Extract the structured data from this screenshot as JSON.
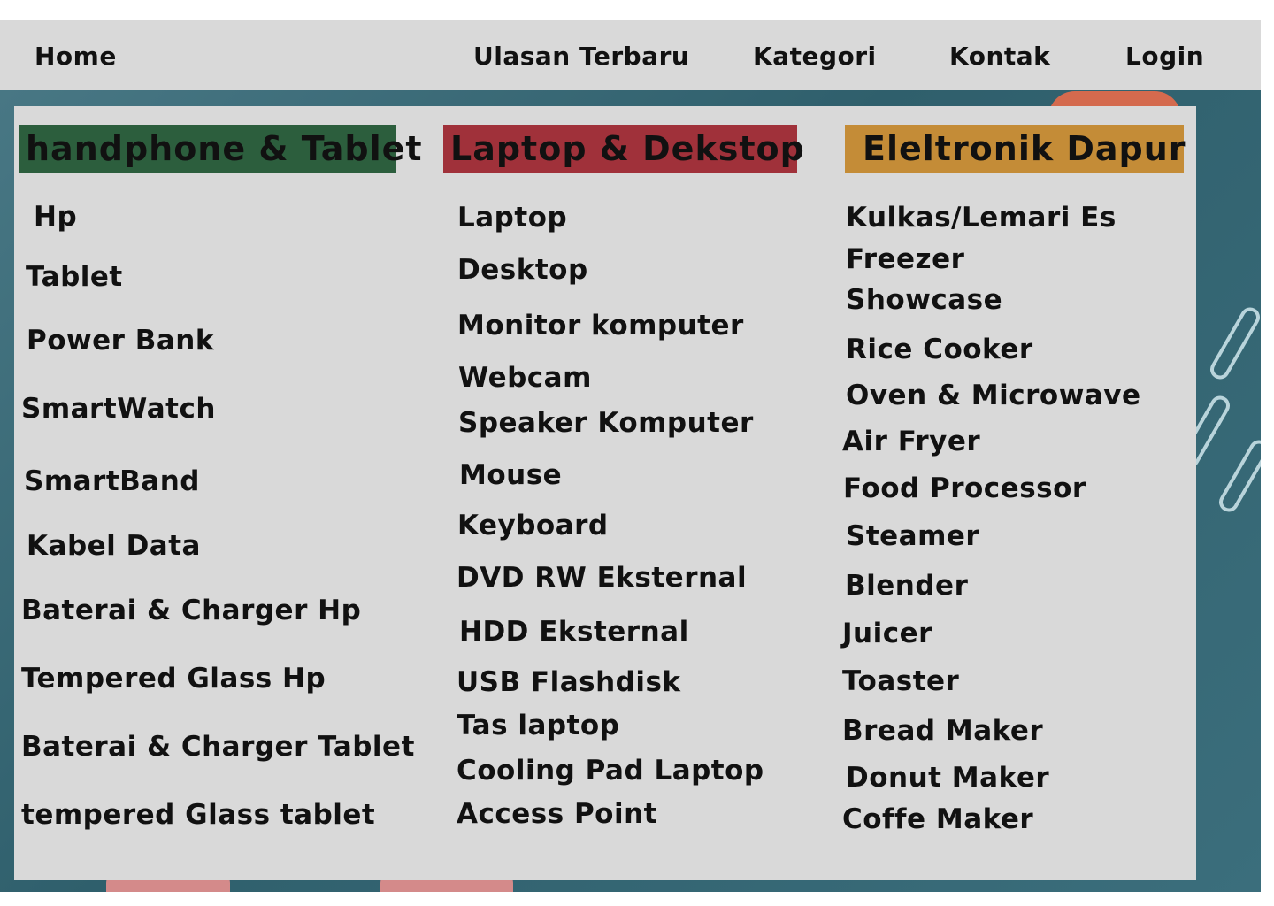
{
  "nav": {
    "home": "Home",
    "ulasan": "Ulasan Terbaru",
    "kategori": "Kategori",
    "kontak": "Kontak",
    "login": "Login"
  },
  "colors": {
    "col1_header": "#2c5e3d",
    "col2_header": "#a0313a",
    "col3_header": "#c48c37"
  },
  "categories": [
    {
      "title": "handphone & Tablet",
      "items": [
        "Hp",
        "Tablet",
        "Power Bank",
        "SmartWatch",
        "SmartBand",
        "Kabel Data",
        "Baterai & Charger Hp",
        "Tempered Glass Hp",
        "Baterai & Charger Tablet",
        "tempered Glass tablet"
      ]
    },
    {
      "title": "Laptop & Dekstop",
      "items": [
        "Laptop",
        "Desktop",
        "Monitor komputer",
        "Webcam",
        "Speaker Komputer",
        "Mouse",
        "Keyboard",
        "DVD RW Eksternal",
        "HDD Eksternal",
        "USB Flashdisk",
        "Tas laptop",
        "Cooling Pad Laptop",
        "Access Point"
      ]
    },
    {
      "title": "Eleltronik Dapur",
      "items": [
        "Kulkas/Lemari Es",
        "Freezer",
        "Showcase",
        "Rice Cooker",
        "Oven & Microwave",
        "Air Fryer",
        "Food Processor",
        "Steamer",
        "Blender",
        "Juicer",
        "Toaster",
        "Bread Maker",
        "Donut Maker",
        "Coffe Maker"
      ]
    }
  ]
}
